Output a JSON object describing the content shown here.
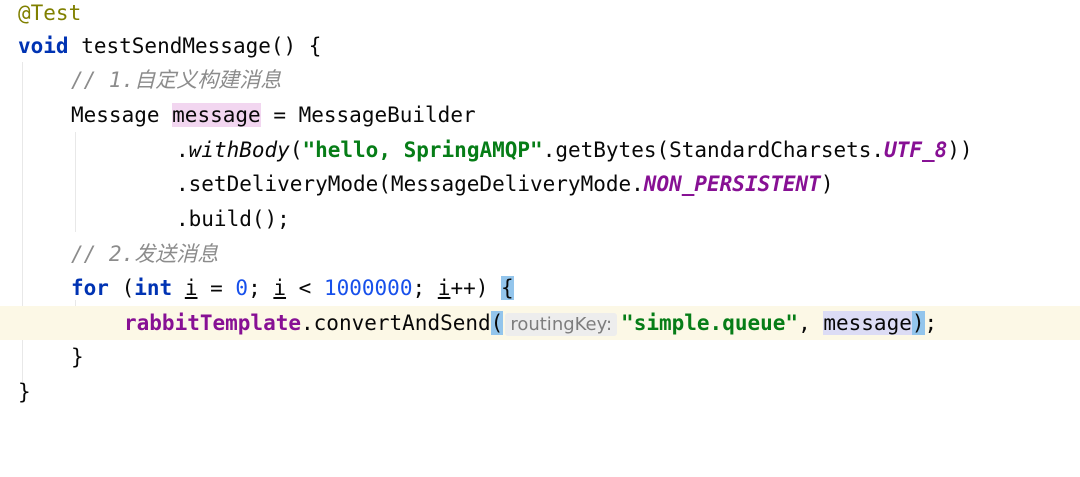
{
  "editor": {
    "annotation": "@Test",
    "void_kw": "void",
    "method_sig": " testSendMessage() {",
    "comment1": "// 1.自定义构建消息",
    "msg_type": "Message ",
    "msg_var": "message",
    "msg_assign": " = MessageBuilder",
    "with_body_dot": ".",
    "with_body": "withBody",
    "with_body_open": "(",
    "hello_str": "\"hello, SpringAMQP\"",
    "get_bytes": ".getBytes(StandardCharsets.",
    "utf8": "UTF_8",
    "close2": "))",
    "set_delivery": ".setDeliveryMode(MessageDeliveryMode.",
    "non_persistent": "NON_PERSISTENT",
    "close1": ")",
    "build": ".build();",
    "comment2": "// 2.发送消息",
    "for_kw": "for",
    "for_open": " (",
    "int_kw": "int",
    "space": " ",
    "i_var": "i",
    "eq": " = ",
    "zero": "0",
    "semi": "; ",
    "lt": " < ",
    "limit": "1000000",
    "inc": "++) ",
    "brace_open": "{",
    "rabbit_field": "rabbitTemplate",
    "convert_send": ".convertAndSend",
    "paren_open": "(",
    "hint_label": "routingKey:",
    "queue_str": "\"simple.queue\"",
    "comma": ", ",
    "msg_arg": "message",
    "paren_close": ")",
    "end_semi": ";",
    "brace_close_inner": "}",
    "brace_close_outer": "}"
  }
}
